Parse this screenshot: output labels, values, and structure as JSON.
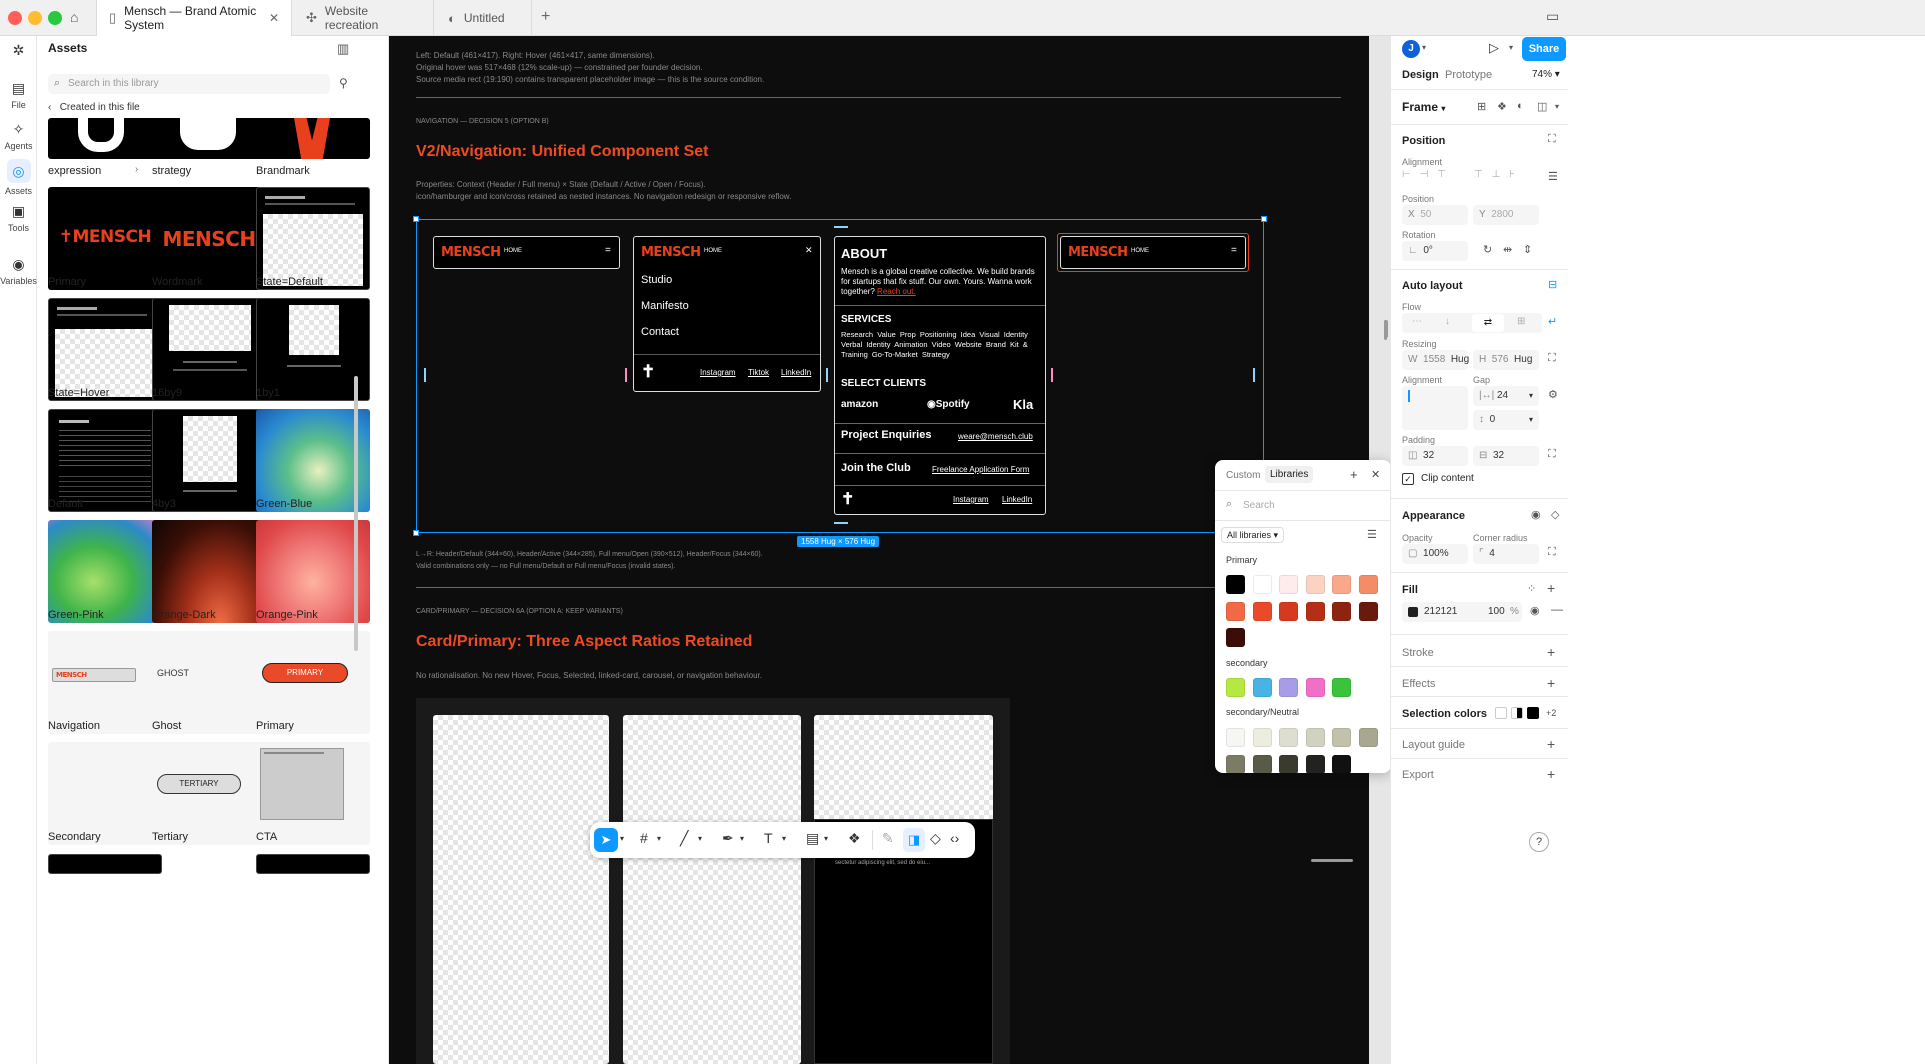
{
  "window": {
    "tabs": [
      {
        "label": "Mensch — Brand Atomic System",
        "active": true
      },
      {
        "label": "Website recreation",
        "active": false
      },
      {
        "label": "Untitled",
        "active": false
      }
    ]
  },
  "rail": {
    "items": [
      {
        "label": "File",
        "icon": "file-icon"
      },
      {
        "label": "Agents",
        "icon": "sparkle-icon"
      },
      {
        "label": "Assets",
        "icon": "assets-icon"
      },
      {
        "label": "Tools",
        "icon": "toolbox-icon"
      },
      {
        "label": "Variables",
        "icon": "variables-icon"
      }
    ]
  },
  "assets": {
    "title": "Assets",
    "search_placeholder": "Search in this library",
    "breadcrumb": "Created in this file",
    "components": [
      {
        "label": "expression"
      },
      {
        "label": "strategy"
      },
      {
        "label": "Brandmark"
      },
      {
        "label": "Primary"
      },
      {
        "label": "Wordmark"
      },
      {
        "label": "State=Default"
      },
      {
        "label": "State=Hover"
      },
      {
        "label": "16by9"
      },
      {
        "label": "1by1"
      },
      {
        "label": "Default"
      },
      {
        "label": "4by3"
      },
      {
        "label": "Green-Blue"
      },
      {
        "label": "Green-Pink"
      },
      {
        "label": "Orange-Dark"
      },
      {
        "label": "Orange-Pink"
      },
      {
        "label": "Navigation"
      },
      {
        "label": "Ghost"
      },
      {
        "label": "Primary"
      },
      {
        "label": "Secondary"
      },
      {
        "label": "Tertiary"
      },
      {
        "label": "CTA"
      }
    ],
    "thumb_text": {
      "mensch": "MENSCH",
      "ghost": "GHOST",
      "primary_btn": "PRIMARY",
      "tertiary": "TERTIARY"
    }
  },
  "canvas": {
    "caption_top": [
      "Left: Default (461×417). Right: Hover (461×417, same dimensions).",
      "Original hover was 517×468 (12% scale-up) — constrained per founder decision.",
      "Source media rect (19:190) contains transparent placeholder image — this is the source condition."
    ],
    "nav_eyebrow": "NAVIGATION — DECISION 5 (OPTION B)",
    "nav_title": "V2/Navigation: Unified Component Set",
    "nav_desc": [
      "Properties: Context (Header / Full menu) × State (Default / Active / Open / Focus).",
      "icon/hamburger and icon/cross retained as nested instances. No navigation redesign or responsive reflow."
    ],
    "mensch": "MENSCH",
    "home": "HOME",
    "menu_items": [
      "Studio",
      "Manifesto",
      "Contact"
    ],
    "social": [
      "Instagram",
      "Tiktok",
      "LinkedIn"
    ],
    "about": {
      "title": "ABOUT",
      "body": "Mensch is a global creative collective. We build brands for startups that fix stuff. Our own. Yours. Wanna work together?",
      "link": "Reach out.",
      "services_title": "SERVICES",
      "services": [
        "Research",
        "Value Prop",
        "Positioning",
        "Idea",
        "Visual Identity",
        "Verbal Identity",
        "Animation",
        "Video",
        "Website",
        "Brand Kit & Training",
        "Go-To-Market Strategy"
      ],
      "clients_title": "SELECT CLIENTS",
      "clients": [
        "amazon",
        "Spotify",
        "Klarna"
      ],
      "enquiries": "Project Enquiries",
      "email": "weare@mensch.club",
      "join": "Join the Club",
      "freelance": "Freelance Application Form",
      "social": [
        "Instagram",
        "LinkedIn"
      ]
    },
    "size_badge": "1558 Hug × 576 Hug",
    "nav_caption": [
      "L→R: Header/Default (344×60), Header/Active (344×285), Full menu/Open (390×512), Header/Focus (344×60).",
      "Valid combinations only — no Full menu/Default or Full menu/Focus (invalid states)."
    ],
    "card_eyebrow": "CARD/PRIMARY — DECISION 6A (OPTION A: KEEP VARIANTS)",
    "card_title": "Card/Primary: Three Aspect Ratios Retained",
    "card_desc": "No rationalisation. No new Hover, Focus, Selected, linked-card, carousel, or navigation behaviour.",
    "card_footer_text": "sectetur adipiscing elit, sed do eiu..."
  },
  "right_panel": {
    "avatar": "J",
    "share": "Share",
    "tabs": [
      "Design",
      "Prototype"
    ],
    "zoom": "74%",
    "frame": "Frame",
    "position": {
      "title": "Position",
      "alignment": "Alignment",
      "position_label": "Position",
      "x_label": "X",
      "x": "50",
      "y_label": "Y",
      "y": "2800",
      "rotation": "Rotation",
      "rotation_value": "0°"
    },
    "auto_layout": {
      "title": "Auto layout",
      "flow": "Flow",
      "resizing": "Resizing",
      "w_label": "W",
      "w": "1558",
      "w_mode": "Hug",
      "h_label": "H",
      "h": "576",
      "h_mode": "Hug",
      "alignment": "Alignment",
      "gap": "Gap",
      "gap_value": "24",
      "gap2": "0",
      "padding": "Padding",
      "pad_h": "32",
      "pad_v": "32",
      "clip": "Clip content"
    },
    "appearance": {
      "title": "Appearance",
      "opacity_label": "Opacity",
      "opacity": "100%",
      "radius_label": "Corner radius",
      "radius": "4"
    },
    "fill": {
      "title": "Fill",
      "hex": "212121",
      "opacity": "100",
      "pct": "%",
      "color": "#212121"
    },
    "stroke": "Stroke",
    "effects": "Effects",
    "selection_colors": "Selection colors",
    "selection_more": "+2",
    "layout_guide": "Layout guide",
    "export": "Export",
    "help": "?"
  },
  "libraries_popup": {
    "tabs": [
      "Custom",
      "Libraries"
    ],
    "search_placeholder": "Search",
    "filter": "All libraries",
    "groups": [
      {
        "name": "Primary",
        "colors": [
          "#000000",
          "#ffffff",
          "#fdecea",
          "#fbd3c3",
          "#f9a98a",
          "#f58c68",
          "#f06b45",
          "#ea4a28",
          "#d63a1e",
          "#b52f17",
          "#8e2410",
          "#6a1a0c",
          "#3a0e06"
        ]
      },
      {
        "name": "secondary",
        "colors": [
          "#b6e842",
          "#4ab3e6",
          "#a89be8",
          "#f070c8",
          "#3cc33c"
        ]
      },
      {
        "name": "secondary/Neutral",
        "colors": [
          "#f6f6f3",
          "#ececdf",
          "#deded0",
          "#d2d2c0",
          "#c2c2ac",
          "#a8a890",
          "#7b7b66",
          "#5a5a48",
          "#3a3a2e",
          "#222220",
          "#111111"
        ]
      }
    ]
  }
}
